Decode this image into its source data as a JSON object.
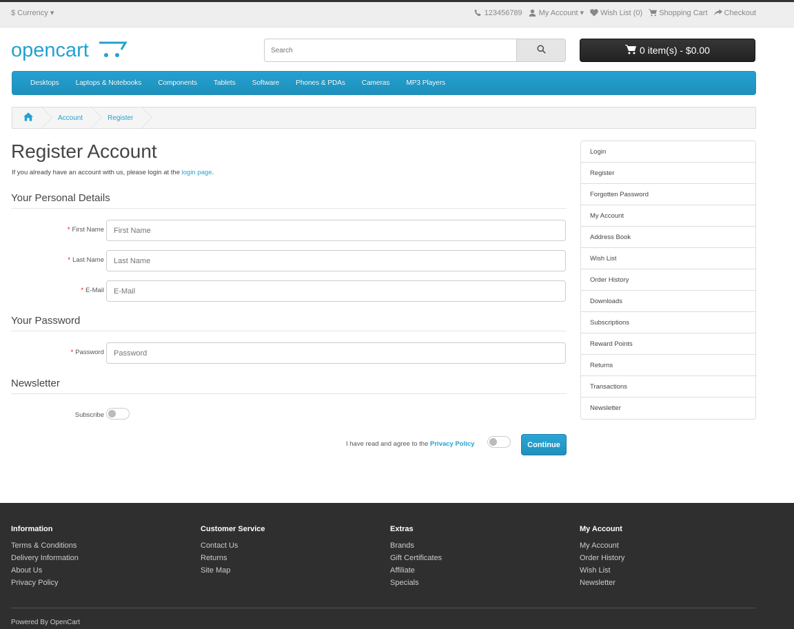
{
  "topbar": {
    "currency": "$ Currency",
    "phone": "123456789",
    "my_account": "My Account",
    "wishlist": "Wish List (0)",
    "shopping_cart": "Shopping Cart",
    "checkout": "Checkout"
  },
  "header": {
    "logo_text": "opencart",
    "search_placeholder": "Search",
    "cart_label": "0 item(s) - $0.00"
  },
  "menu": [
    "Desktops",
    "Laptops & Notebooks",
    "Components",
    "Tablets",
    "Software",
    "Phones & PDAs",
    "Cameras",
    "MP3 Players"
  ],
  "breadcrumb": [
    "Account",
    "Register"
  ],
  "page": {
    "title": "Register Account",
    "intro_text": "If you already have an account with us, please login at the",
    "intro_link": "login page",
    "intro_end": "."
  },
  "sections": {
    "personal": "Your Personal Details",
    "password": "Your Password",
    "newsletter": "Newsletter"
  },
  "fields": {
    "firstname": {
      "label": "First Name",
      "placeholder": "First Name"
    },
    "lastname": {
      "label": "Last Name",
      "placeholder": "Last Name"
    },
    "email": {
      "label": "E-Mail",
      "placeholder": "E-Mail"
    },
    "password": {
      "label": "Password",
      "placeholder": "Password"
    },
    "subscribe": {
      "label": "Subscribe"
    }
  },
  "agree": {
    "text": "I have read and agree to the",
    "link": "Privacy Policy"
  },
  "continue_label": "Continue",
  "sidebar": [
    "Login",
    "Register",
    "Forgotten Password",
    "My Account",
    "Address Book",
    "Wish List",
    "Order History",
    "Downloads",
    "Subscriptions",
    "Reward Points",
    "Returns",
    "Transactions",
    "Newsletter"
  ],
  "footer": {
    "columns": [
      {
        "title": "Information",
        "links": [
          "Terms & Conditions",
          "Delivery Information",
          "About Us",
          "Privacy Policy"
        ]
      },
      {
        "title": "Customer Service",
        "links": [
          "Contact Us",
          "Returns",
          "Site Map"
        ]
      },
      {
        "title": "Extras",
        "links": [
          "Brands",
          "Gift Certificates",
          "Affiliate",
          "Specials"
        ]
      },
      {
        "title": "My Account",
        "links": [
          "My Account",
          "Order History",
          "Wish List",
          "Newsletter"
        ]
      }
    ],
    "powered": "Powered By OpenCart"
  },
  "colors": {
    "accent": "#23a1d1",
    "footer_bg": "#2f2f2f",
    "cart_bg": "#222222"
  }
}
